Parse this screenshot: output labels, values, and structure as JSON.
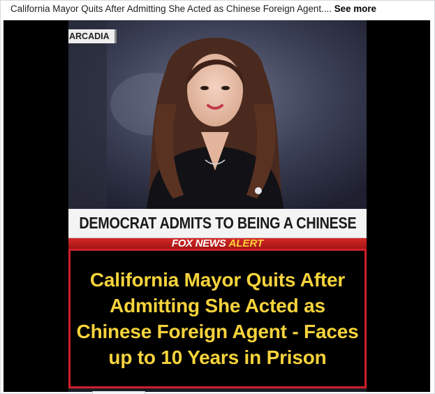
{
  "post": {
    "caption": "California Mayor Quits After Admitting She Acted as Chinese Foreign Agent....",
    "see_more": "See more"
  },
  "image": {
    "place_tag": "ARCADIA",
    "headline": "DEMOCRAT ADMITS TO BEING A CHINESE",
    "brand_network": "FOX NEWS",
    "brand_alert": "ALERT",
    "story_text": "California Mayor Quits After Admitting She Acted as Chinese Foreign Agent - Faces up to 10 Years in Prison"
  },
  "colors": {
    "headline_box_border": "#cf1f2b",
    "story_text": "#f6d33c",
    "alert_text": "#ffd23a"
  },
  "icons": [
    "fox-news-logo"
  ]
}
